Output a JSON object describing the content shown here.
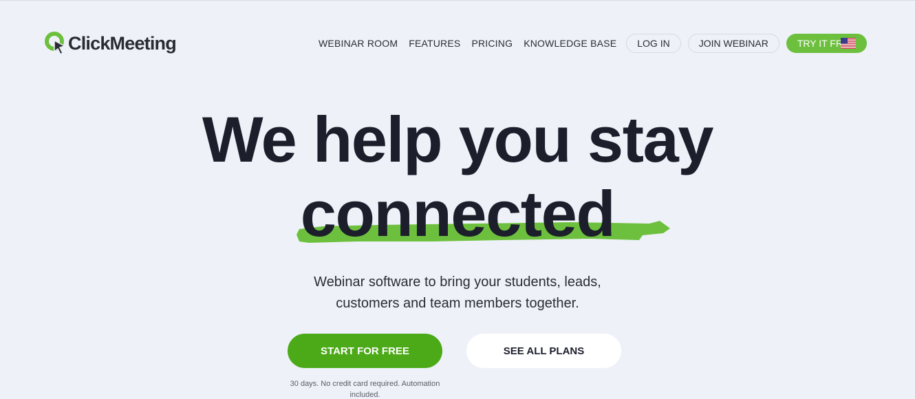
{
  "brand": {
    "name": "ClickMeeting",
    "accent": "#6dc03d",
    "accent_dark": "#4caa19"
  },
  "nav": {
    "links": [
      "WEBINAR ROOM",
      "FEATURES",
      "PRICING",
      "KNOWLEDGE BASE"
    ],
    "login": "LOG IN",
    "join": "JOIN WEBINAR",
    "try_free": "TRY IT FREE",
    "language_icon": "us-flag-icon"
  },
  "hero": {
    "headline_line1": "We help you stay",
    "headline_line2": "connected",
    "subtitle_line1": "Webinar software to bring your students, leads,",
    "subtitle_line2": "customers and team members together.",
    "primary_cta": "START FOR FREE",
    "secondary_cta": "SEE ALL PLANS",
    "note": "30 days. No credit card required. Automation included."
  }
}
